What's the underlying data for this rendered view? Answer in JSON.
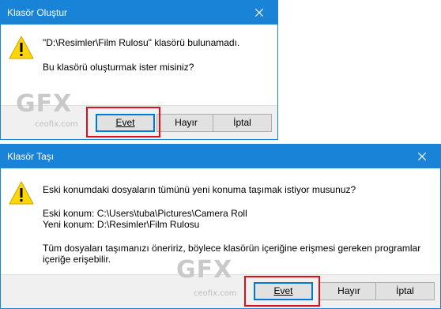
{
  "dialog1": {
    "title": "Klasör Oluştur",
    "message_line1": "\"D:\\Resimler\\Film Rulosu\" klasörü bulunamadı.",
    "message_line2": "Bu klasörü oluşturmak ister misiniz?",
    "buttons": {
      "yes": "Evet",
      "no": "Hayır",
      "cancel": "İptal"
    }
  },
  "dialog2": {
    "title": "Klasör Taşı",
    "message_line1": "Eski konumdaki dosyaların tümünü yeni konuma taşımak istiyor musunuz?",
    "old_location": "Eski konum: C:\\Users\\tuba\\Pictures\\Camera Roll",
    "new_location": "Yeni konum: D:\\Resimler\\Film Rulosu",
    "recommendation_line1": "Tüm dosyaları taşımanızı öneririz, böylece klasörün içeriğine erişmesi gereken programlar",
    "recommendation_line2": "içeriğe erişebilir.",
    "buttons": {
      "yes": "Evet",
      "no": "Hayır",
      "cancel": "İptal"
    }
  },
  "watermark": {
    "logo": "GFX",
    "site": "ceofix.com"
  },
  "colors": {
    "titlebar": "#1883d7",
    "highlight": "#e0101a",
    "footer": "#f0f0f0",
    "warning": "#ffd700"
  },
  "icons": {
    "warning": "warning-icon",
    "close": "close-icon"
  }
}
